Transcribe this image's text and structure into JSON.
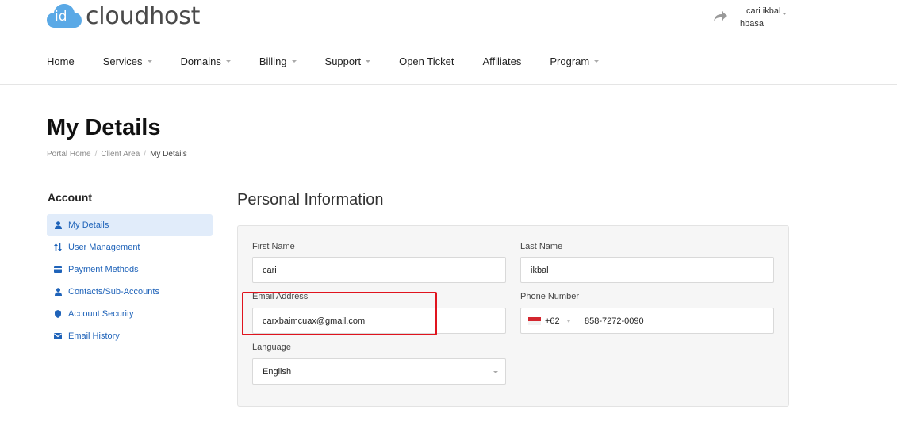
{
  "brand": {
    "logo_badge": "id",
    "name": "cloudhost"
  },
  "user": {
    "first_line": "cari ikbal",
    "second_line": "hbasa"
  },
  "nav": {
    "items": [
      {
        "label": "Home",
        "dropdown": false
      },
      {
        "label": "Services",
        "dropdown": true
      },
      {
        "label": "Domains",
        "dropdown": true
      },
      {
        "label": "Billing",
        "dropdown": true
      },
      {
        "label": "Support",
        "dropdown": true
      },
      {
        "label": "Open Ticket",
        "dropdown": false
      },
      {
        "label": "Affiliates",
        "dropdown": false
      },
      {
        "label": "Program",
        "dropdown": true
      }
    ]
  },
  "page": {
    "title": "My Details",
    "breadcrumb": [
      "Portal Home",
      "Client Area",
      "My Details"
    ]
  },
  "sidebar": {
    "title": "Account",
    "items": [
      {
        "label": "My Details",
        "icon": "user-icon",
        "active": true
      },
      {
        "label": "User Management",
        "icon": "sort-arrows-icon",
        "active": false
      },
      {
        "label": "Payment Methods",
        "icon": "credit-card-icon",
        "active": false
      },
      {
        "label": "Contacts/Sub-Accounts",
        "icon": "user-icon",
        "active": false
      },
      {
        "label": "Account Security",
        "icon": "shield-icon",
        "active": false
      },
      {
        "label": "Email History",
        "icon": "envelope-icon",
        "active": false
      }
    ]
  },
  "form": {
    "section_title": "Personal Information",
    "first_name": {
      "label": "First Name",
      "value": "cari"
    },
    "last_name": {
      "label": "Last Name",
      "value": "ikbal"
    },
    "email": {
      "label": "Email Address",
      "value": "carxbaimcuax@gmail.com"
    },
    "phone": {
      "label": "Phone Number",
      "dial_code": "+62",
      "number": "858-7272-0090",
      "flag": "Indonesia"
    },
    "language": {
      "label": "Language",
      "value": "English"
    }
  },
  "colors": {
    "link": "#1f63b9",
    "active_bg": "#e1ecfa",
    "logo_blue": "#5aa9e6",
    "highlight": "#e0141e"
  }
}
